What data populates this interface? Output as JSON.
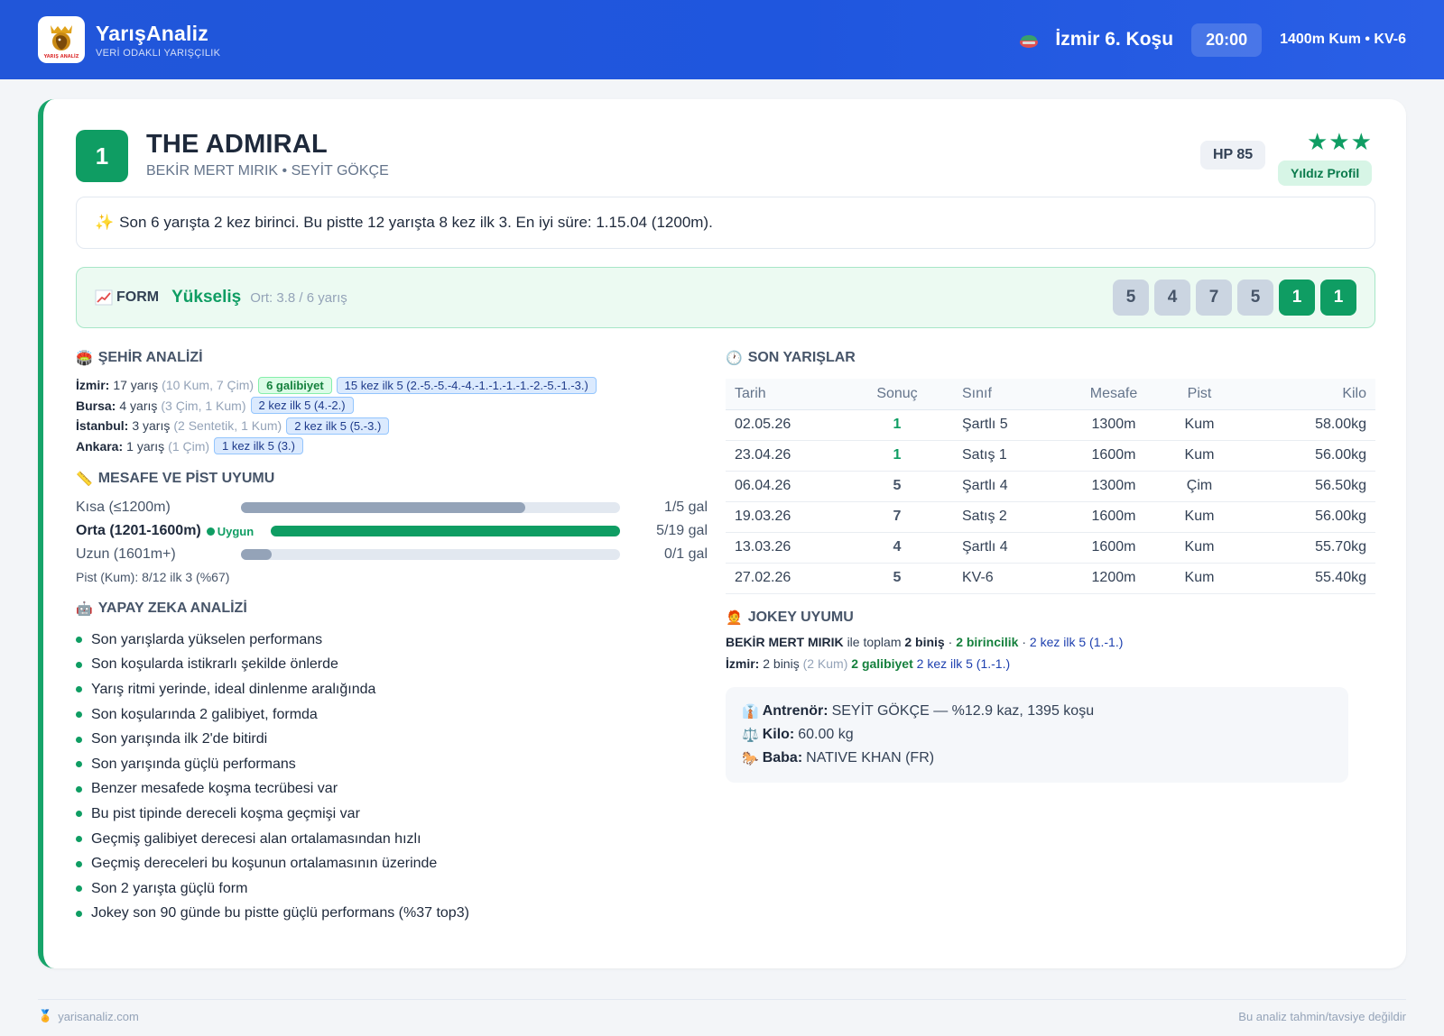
{
  "header": {
    "brand": "YarışAnaliz",
    "tagline": "VERİ ODAKLI YARIŞÇILIK",
    "race_title": "İzmir 6. Koşu",
    "time": "20:00",
    "race_meta": "1400m Kum • KV-6",
    "logo_text": "YARIŞ ANALİZ"
  },
  "horse": {
    "number": "1",
    "name": "THE ADMIRAL",
    "subtitle": "BEKİR MERT MIRIK • SEYİT GÖKÇE",
    "hp": "HP 85",
    "stars": "★★★",
    "star_label": "Yıldız Profil"
  },
  "summary": "Son 6 yarışta 2 kez birinci. Bu pistte 12 yarışta 8 kez ilk 3. En iyi süre: 1.15.04 (1200m).",
  "form": {
    "label": "FORM",
    "trend": "Yükseliş",
    "avg": "Ort: 3.8 / 6 yarış",
    "results": [
      "5",
      "4",
      "7",
      "5",
      "1",
      "1"
    ]
  },
  "city": {
    "title": "ŞEHİR ANALİZİ",
    "rows": [
      {
        "city": "İzmir:",
        "count": "17 yarış",
        "detail": "(10 Kum, 7 Çim)",
        "win_tag": "6 galibiyet",
        "top_tag": "15 kez ilk 5 (2.-5.-5.-4.-4.-1.-1.-1.-1.-2.-5.-1.-3.)"
      },
      {
        "city": "Bursa:",
        "count": "4 yarış",
        "detail": "(3 Çim, 1 Kum)",
        "top_tag": "2 kez ilk 5 (4.-2.)"
      },
      {
        "city": "İstanbul:",
        "count": "3 yarış",
        "detail": "(2 Sentetik, 1 Kum)",
        "top_tag": "2 kez ilk 5 (5.-3.)"
      },
      {
        "city": "Ankara:",
        "count": "1 yarış",
        "detail": "(1 Çim)",
        "top_tag": "1 kez ilk 5 (3.)"
      }
    ]
  },
  "distance": {
    "title": "MESAFE VE PİST UYUMU",
    "rows": [
      {
        "label": "Kısa (≤1200m)",
        "value": "1/5 gal",
        "fill": 0.75
      },
      {
        "label": "Orta (1201-1600m)",
        "badge": "Uygun",
        "value": "5/19 gal",
        "fill": 1.0
      },
      {
        "label": "Uzun (1601m+)",
        "value": "0/1 gal",
        "fill": 0.08
      }
    ],
    "pist": "Pist (Kum): 8/12 ilk 3 (%67)"
  },
  "ai": {
    "title": "YAPAY ZEKA ANALİZİ",
    "items": [
      "Son yarışlarda yükselen performans",
      "Son koşularda istikrarlı şekilde önlerde",
      "Yarış ritmi yerinde, ideal dinlenme aralığında",
      "Son koşularında 2 galibiyet, formda",
      "Son yarışında ilk 2'de bitirdi",
      "Son yarışında güçlü performans",
      "Benzer mesafede koşma tecrübesi var",
      "Bu pist tipinde dereceli koşma geçmişi var",
      "Geçmiş galibiyet derecesi alan ortalamasından hızlı",
      "Geçmiş dereceleri bu koşunun ortalamasının üzerinde",
      "Son 2 yarışta güçlü form",
      "Jokey son 90 günde bu pistte güçlü performans (%37 top3)"
    ]
  },
  "recent": {
    "title": "SON YARIŞLAR",
    "columns": [
      "Tarih",
      "Sonuç",
      "Sınıf",
      "Mesafe",
      "Pist",
      "Kilo"
    ],
    "rows": [
      {
        "date": "02.05.26",
        "result": "1",
        "class": "Şartlı 5",
        "dist": "1300m",
        "pist": "Kum",
        "kilo": "58.00kg"
      },
      {
        "date": "23.04.26",
        "result": "1",
        "class": "Satış 1",
        "dist": "1600m",
        "pist": "Kum",
        "kilo": "56.00kg"
      },
      {
        "date": "06.04.26",
        "result": "5",
        "class": "Şartlı 4",
        "dist": "1300m",
        "pist": "Çim",
        "kilo": "56.50kg"
      },
      {
        "date": "19.03.26",
        "result": "7",
        "class": "Satış 2",
        "dist": "1600m",
        "pist": "Kum",
        "kilo": "56.00kg"
      },
      {
        "date": "13.03.26",
        "result": "4",
        "class": "Şartlı 4",
        "dist": "1600m",
        "pist": "Kum",
        "kilo": "55.70kg"
      },
      {
        "date": "27.02.26",
        "result": "5",
        "class": "KV-6",
        "dist": "1200m",
        "pist": "Kum",
        "kilo": "55.40kg"
      }
    ]
  },
  "jockey": {
    "title": "JOKEY UYUMU",
    "name": "BEKİR MERT MIRIK",
    "with_total": "ile toplam",
    "rides": "2 biniş",
    "sep1": "·",
    "wins": "2 birincilik",
    "sep2": "·",
    "top5": "2 kez ilk 5 (1.-1.)",
    "city": "İzmir:",
    "city_rides": "2 biniş",
    "city_detail": "(2 Kum)",
    "city_wins": "2 galibiyet",
    "city_top5": "2 kez ilk 5 (1.-1.)"
  },
  "info": {
    "trainer_label": "Antrenör:",
    "trainer": "SEYİT GÖKÇE — %12.9 kaz, 1395 koşu",
    "kilo_label": "Kilo:",
    "kilo": "60.00 kg",
    "sire_label": "Baba:",
    "sire": "NATIVE KHAN (FR)"
  },
  "footer": {
    "site": "yarisanaliz.com",
    "disclaimer": "Bu analiz tahmin/tavsiye değildir"
  },
  "colors": {
    "header_blue": "#1f56de",
    "accent_green": "#0f9d63",
    "form_bg": "#ecfaf2",
    "tag_blue": "#dbeafe"
  }
}
